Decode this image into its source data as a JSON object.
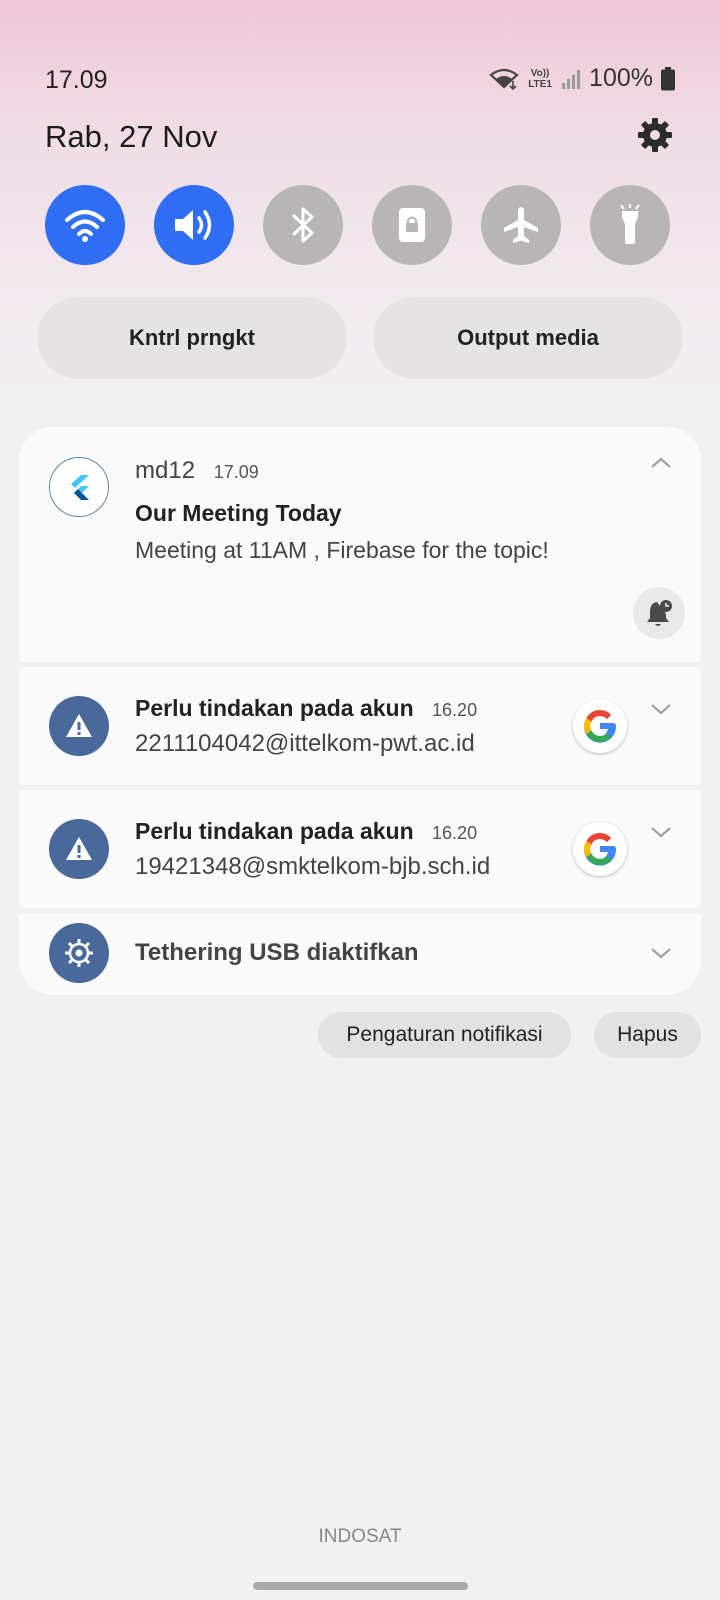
{
  "status_bar": {
    "time": "17.09",
    "battery": "100%",
    "network_label": "Vo)) LTE1"
  },
  "header": {
    "date": "Rab, 27 Nov"
  },
  "quick_tiles": [
    {
      "name": "wifi",
      "state": "on"
    },
    {
      "name": "sound",
      "state": "on"
    },
    {
      "name": "bluetooth",
      "state": "off"
    },
    {
      "name": "screen-lock",
      "state": "off"
    },
    {
      "name": "airplane-mode",
      "state": "off"
    },
    {
      "name": "flashlight",
      "state": "off"
    }
  ],
  "controls": {
    "device_control": "Kntrl prngkt",
    "media_output": "Output media"
  },
  "notifications": [
    {
      "app": "md12",
      "time": "17.09",
      "title": "Our Meeting Today",
      "body": "Meeting at 11AM , Firebase for the topic!"
    },
    {
      "title": "Perlu tindakan pada akun",
      "time": "16.20",
      "body": "2211104042@ittelkom-pwt.ac.id"
    },
    {
      "title": "Perlu tindakan pada akun",
      "time": "16.20",
      "body": "19421348@smktelkom-bjb.sch.id"
    },
    {
      "title": "Tethering USB diaktifkan"
    }
  ],
  "footer": {
    "notif_settings": "Pengaturan notifikasi",
    "clear": "Hapus",
    "carrier": "INDOSAT"
  },
  "colors": {
    "tile_on": "#2f6df2",
    "tile_off": "#b9b5b7",
    "system_icon_bg": "#48699a"
  }
}
